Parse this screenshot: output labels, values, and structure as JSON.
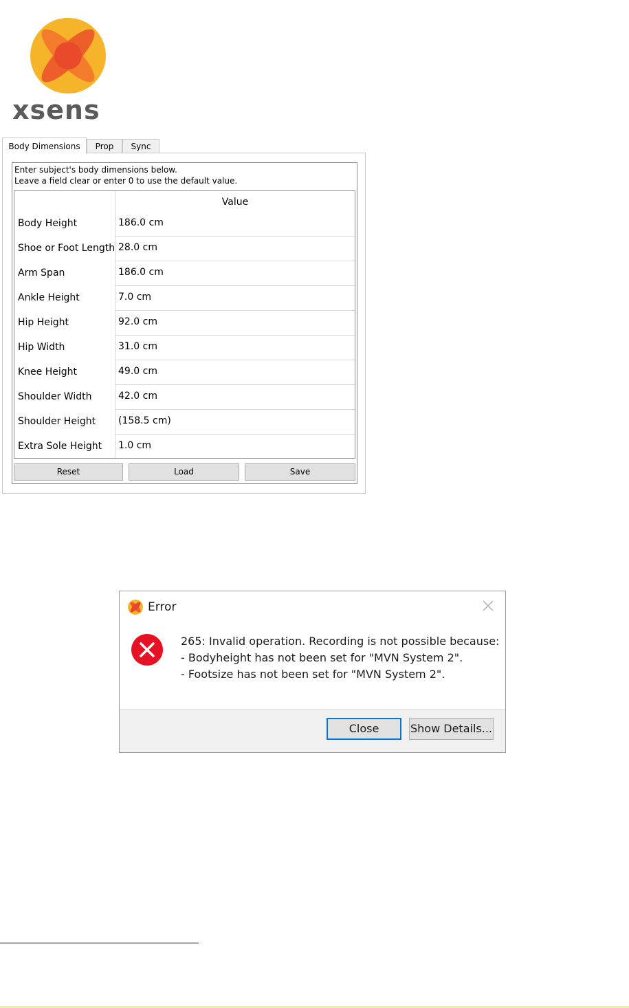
{
  "logo": {
    "wordmark": "xsens",
    "colors": {
      "orange": "#f6a623",
      "red": "#e8452c"
    }
  },
  "tabs": [
    {
      "label": "Body Dimensions",
      "active": true
    },
    {
      "label": "Prop",
      "active": false
    },
    {
      "label": "Sync",
      "active": false
    }
  ],
  "body_dimensions": {
    "intro_line1": "Enter subject's body dimensions below.",
    "intro_line2": "Leave a field clear or enter 0 to use the default value.",
    "value_header": "Value",
    "rows": [
      {
        "label": "Body Height",
        "value": "186.0 cm"
      },
      {
        "label": "Shoe or Foot Length",
        "value": "28.0 cm"
      },
      {
        "label": "Arm Span",
        "value": "186.0 cm"
      },
      {
        "label": "Ankle Height",
        "value": "7.0 cm"
      },
      {
        "label": "Hip Height",
        "value": "92.0 cm"
      },
      {
        "label": "Hip Width",
        "value": "31.0 cm"
      },
      {
        "label": "Knee Height",
        "value": "49.0 cm"
      },
      {
        "label": "Shoulder Width",
        "value": "42.0 cm"
      },
      {
        "label": "Shoulder Height",
        "value": "(158.5 cm)"
      },
      {
        "label": "Extra Sole Height",
        "value": "1.0 cm"
      }
    ],
    "buttons": {
      "reset": "Reset",
      "load": "Load",
      "save": "Save"
    }
  },
  "error_dialog": {
    "title": "Error",
    "icon": "error-x-icon",
    "message_lines": [
      "265: Invalid operation. Recording is not possible because:",
      "- Bodyheight has not been set for \"MVN System 2\".",
      "- Footsize has not been set for \"MVN System 2\"."
    ],
    "close_label": "Close",
    "details_label": "Show Details...",
    "colors": {
      "error_red": "#e81123",
      "default_button_border": "#0078d7"
    }
  }
}
